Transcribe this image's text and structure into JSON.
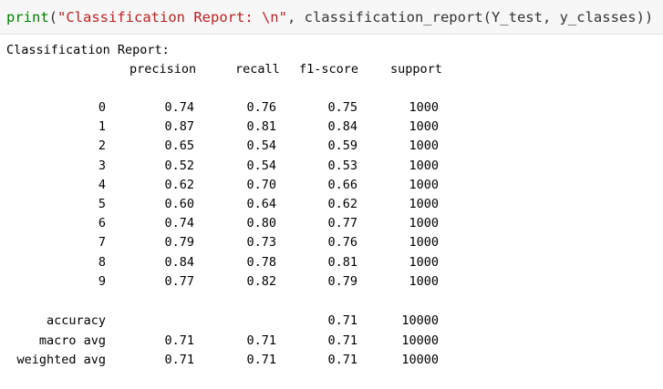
{
  "code": {
    "fn": "print",
    "open_paren": "(",
    "string": "\"Classification Report: \\n\"",
    "rest": ", classification_report(Y_test, y_classes))"
  },
  "output": {
    "title": "Classification Report:",
    "headers": {
      "precision": "precision",
      "recall": "recall",
      "f1": "f1-score",
      "support": "support"
    },
    "class_rows": [
      {
        "label": "0",
        "precision": "0.74",
        "recall": "0.76",
        "f1": "0.75",
        "support": "1000"
      },
      {
        "label": "1",
        "precision": "0.87",
        "recall": "0.81",
        "f1": "0.84",
        "support": "1000"
      },
      {
        "label": "2",
        "precision": "0.65",
        "recall": "0.54",
        "f1": "0.59",
        "support": "1000"
      },
      {
        "label": "3",
        "precision": "0.52",
        "recall": "0.54",
        "f1": "0.53",
        "support": "1000"
      },
      {
        "label": "4",
        "precision": "0.62",
        "recall": "0.70",
        "f1": "0.66",
        "support": "1000"
      },
      {
        "label": "5",
        "precision": "0.60",
        "recall": "0.64",
        "f1": "0.62",
        "support": "1000"
      },
      {
        "label": "6",
        "precision": "0.74",
        "recall": "0.80",
        "f1": "0.77",
        "support": "1000"
      },
      {
        "label": "7",
        "precision": "0.79",
        "recall": "0.73",
        "f1": "0.76",
        "support": "1000"
      },
      {
        "label": "8",
        "precision": "0.84",
        "recall": "0.78",
        "f1": "0.81",
        "support": "1000"
      },
      {
        "label": "9",
        "precision": "0.77",
        "recall": "0.82",
        "f1": "0.79",
        "support": "1000"
      }
    ],
    "summary_rows": [
      {
        "label": "accuracy",
        "precision": "",
        "recall": "",
        "f1": "0.71",
        "support": "10000"
      },
      {
        "label": "macro avg",
        "precision": "0.71",
        "recall": "0.71",
        "f1": "0.71",
        "support": "10000"
      },
      {
        "label": "weighted avg",
        "precision": "0.71",
        "recall": "0.71",
        "f1": "0.71",
        "support": "10000"
      }
    ]
  }
}
